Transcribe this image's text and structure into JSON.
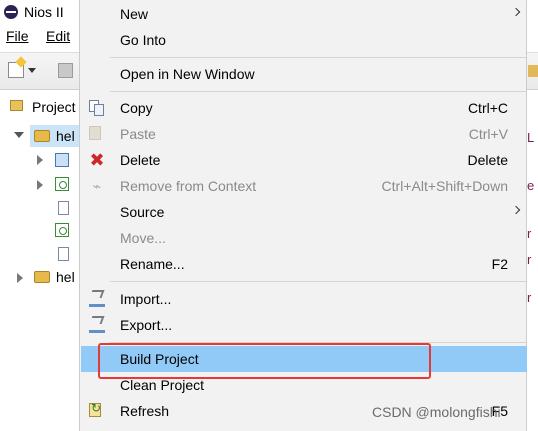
{
  "window": {
    "title": "Nios II"
  },
  "menubar": {
    "file": "File",
    "edit": "Edit"
  },
  "project_explorer": {
    "tab_label": "Project",
    "tree": [
      {
        "label": "hel",
        "expanded": true,
        "selected": true
      },
      {
        "label": "hel",
        "expanded": false,
        "selected": false
      }
    ]
  },
  "context_menu": {
    "items": [
      {
        "label": "New",
        "submenu": true,
        "enabled": true,
        "icon": ""
      },
      {
        "label": "Go Into",
        "enabled": true,
        "icon": ""
      },
      {
        "label": "Open in New Window",
        "enabled": true,
        "icon": ""
      },
      {
        "label": "Copy",
        "shortcut": "Ctrl+C",
        "enabled": true,
        "icon": "copy-icon"
      },
      {
        "label": "Paste",
        "shortcut": "Ctrl+V",
        "enabled": false,
        "icon": "paste-icon"
      },
      {
        "label": "Delete",
        "shortcut": "Delete",
        "enabled": true,
        "icon": "delete-icon"
      },
      {
        "label": "Remove from Context",
        "shortcut": "Ctrl+Alt+Shift+Down",
        "enabled": false,
        "icon": "remove-from-context-icon"
      },
      {
        "label": "Source",
        "submenu": true,
        "enabled": true,
        "icon": ""
      },
      {
        "label": "Move...",
        "enabled": false,
        "icon": ""
      },
      {
        "label": "Rename...",
        "shortcut": "F2",
        "enabled": true,
        "icon": ""
      },
      {
        "label": "Import...",
        "enabled": true,
        "icon": "import-icon"
      },
      {
        "label": "Export...",
        "enabled": true,
        "icon": "export-icon"
      },
      {
        "label": "Build Project",
        "enabled": true,
        "highlighted": true,
        "icon": ""
      },
      {
        "label": "Clean Project",
        "enabled": true,
        "icon": ""
      },
      {
        "label": "Refresh",
        "shortcut": "F5",
        "enabled": true,
        "icon": "refresh-icon"
      }
    ]
  },
  "right_edge_fragments": [
    "L",
    "e",
    "r",
    "r",
    "r"
  ],
  "watermark": "CSDN @molongfishi",
  "colors": {
    "highlight": "#91c9f7",
    "annotation_box": "#e53935",
    "menu_bg": "#f2f2f2"
  }
}
